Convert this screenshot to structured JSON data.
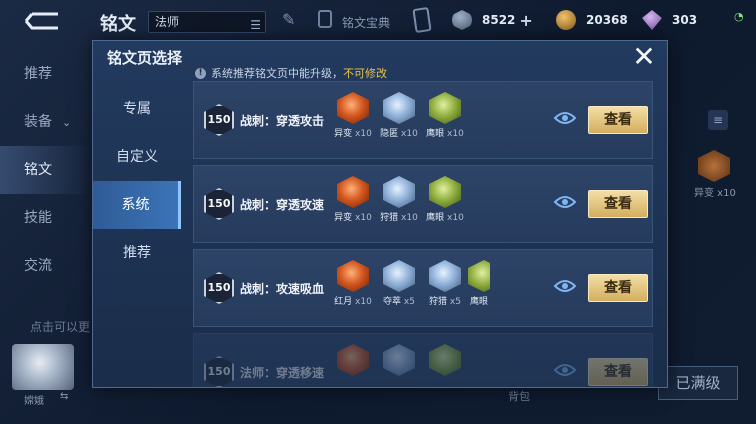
{
  "topbar": {
    "title": "铭文",
    "hero": "法师",
    "treasure_label": "铭文宝典",
    "currencies": [
      {
        "icon": "diamond-coin-icon",
        "value": "8522"
      },
      {
        "icon": "gold-coin-icon",
        "value": "20368"
      },
      {
        "icon": "gem-icon",
        "value": "303"
      }
    ]
  },
  "background_nav": {
    "items": [
      {
        "label": "推荐"
      },
      {
        "label": "装备"
      },
      {
        "label": "铭文"
      },
      {
        "label": "技能"
      },
      {
        "label": "交流"
      }
    ],
    "hint": "点击可以更",
    "avatar_name": "嫦娥"
  },
  "background_right": {
    "rune_label": "异变 x10",
    "max_button": "已满级",
    "backpack": "背包"
  },
  "modal": {
    "title": "铭文页选择",
    "notice_text": "系统推荐铭文页中能升级，",
    "notice_warning": "不可修改",
    "tabs": [
      {
        "label": "专属",
        "active": false
      },
      {
        "label": "自定义",
        "active": false
      },
      {
        "label": "系统",
        "active": true
      },
      {
        "label": "推荐",
        "active": false
      }
    ],
    "rows": [
      {
        "level": "150",
        "name": "战刺：穿透攻击",
        "view_label": "查看",
        "runes": [
          {
            "name": "异变",
            "count": "x10",
            "color": "red"
          },
          {
            "name": "隐匿",
            "count": "x10",
            "color": "blue"
          },
          {
            "name": "鹰眼",
            "count": "x10",
            "color": "green"
          }
        ]
      },
      {
        "level": "150",
        "name": "战刺：穿透攻速",
        "view_label": "查看",
        "runes": [
          {
            "name": "异变",
            "count": "x10",
            "color": "red"
          },
          {
            "name": "狩猎",
            "count": "x10",
            "color": "blue"
          },
          {
            "name": "鹰眼",
            "count": "x10",
            "color": "green"
          }
        ]
      },
      {
        "level": "150",
        "name": "战刺：攻速吸血",
        "view_label": "查看",
        "runes": [
          {
            "name": "红月",
            "count": "x10",
            "color": "red"
          },
          {
            "name": "夺萃",
            "count": "x5",
            "color": "blue"
          },
          {
            "name": "狩猎",
            "count": "x5",
            "color": "blue"
          },
          {
            "name": "鹰眼",
            "count": "",
            "color": "green"
          }
        ]
      },
      {
        "level": "150",
        "name": "法师：穿透移速",
        "view_label": "查看",
        "runes": [
          {
            "name": "",
            "count": "",
            "color": "red"
          },
          {
            "name": "",
            "count": "",
            "color": "blue"
          },
          {
            "name": "",
            "count": "",
            "color": "green"
          }
        ]
      }
    ]
  }
}
